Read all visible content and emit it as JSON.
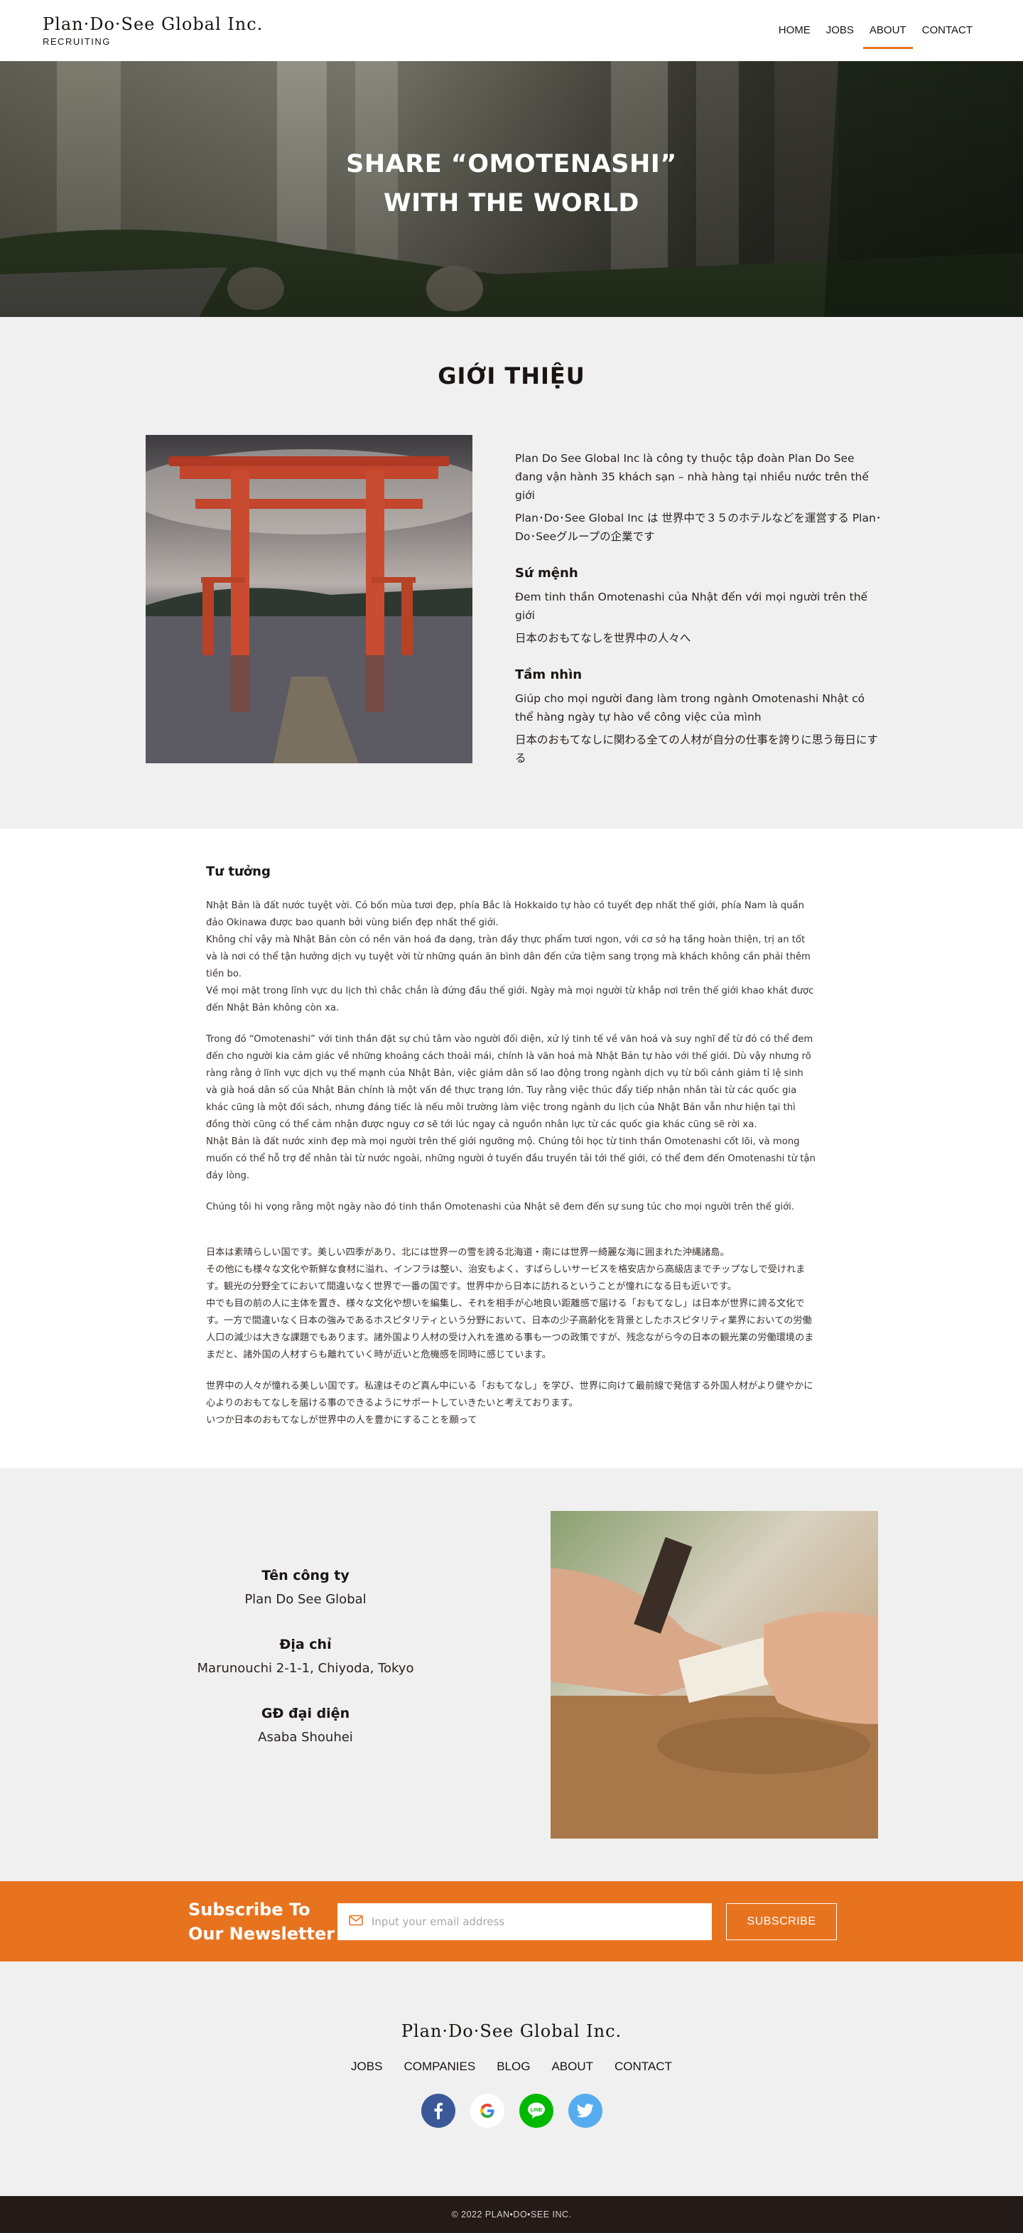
{
  "header": {
    "logo": "Plan·Do·See Global Inc.",
    "logo_sub": "RECRUITING",
    "nav": [
      "HOME",
      "JOBS",
      "ABOUT",
      "CONTACT"
    ],
    "active_nav": "ABOUT",
    "accent_color": "#e8731f"
  },
  "hero": {
    "title_line1": "SHARE “OMOTENASHI”",
    "title_line2": "WITH THE WORLD"
  },
  "intro": {
    "heading": "GIỚI THIỆU",
    "p1": "Plan Do See Global Inc là công ty thuộc tập đoàn Plan Do See đang vận hành 35 khách sạn – nhà hàng tại nhiều nước trên thế giới",
    "p2": "Plan･Do･See Global Inc は 世界中で３５のホテルなどを運営する Plan･Do･Seeグループの企業です",
    "mission_title": "Sứ mệnh",
    "mission_vi": "Đem tinh thần Omotenashi của Nhật đến với mọi người trên thế giới",
    "mission_ja": "日本のおもてなしを世界中の人々へ",
    "vision_title": "Tầm nhìn",
    "vision_vi": "Giúp cho mọi người đang làm trong ngành Omotenashi Nhật có thể hàng ngày tự hào về công việc của mình",
    "vision_ja": "日本のおもてなしに関わる全ての人材が自分の仕事を誇りに思う毎日にする"
  },
  "philosophy": {
    "title": "Tư tưởng",
    "vi_1": "Nhật Bản là đất nước tuyệt vời. Có bốn mùa tươi đẹp, phía Bắc là Hokkaido tự hào có tuyết đẹp nhất thế giới, phía Nam là quần đảo Okinawa được bao quanh bởi vùng biển đẹp nhất thế giới.",
    "vi_2": "Không chỉ vậy mà Nhật Bản còn có nền văn hoá đa dạng, tràn đầy thực phẩm tươi ngon, với cơ sở hạ tầng hoàn thiện, trị an tốt và là nơi có thể tận hưởng dịch vụ tuyệt vời từ những quán ăn bình dân đến cửa tiệm sang trọng mà khách không cần phải thêm tiền bo.",
    "vi_3": "Về mọi mặt trong lĩnh vực du lịch thì chắc chắn là đứng đầu thế giới. Ngày mà mọi người từ khắp nơi trên thế giới khao khát được đến Nhật Bản không còn xa.",
    "vi_4": "Trong đó “Omotenashi” với tinh thần đặt sự chú tâm vào người đối diện, xử lý tinh tế về văn hoá và suy nghĩ để từ đó có thể đem đến cho người kia cảm giác về những khoảng cách thoải mái, chính là văn hoá mà Nhật Bản tự hào với thế giới. Dù vậy nhưng rõ ràng rằng ở lĩnh vực dịch vụ thế mạnh của Nhật Bản, việc giảm dân số lao động trong ngành dịch vụ từ bối cảnh giảm tỉ lệ sinh và già hoá dân số của Nhật Bản chính là một vấn đề thực trạng lớn. Tuy rằng việc thúc đẩy tiếp nhận nhân tài từ các quốc gia khác cũng là một đối sách, nhưng đáng tiếc là nếu môi trường làm việc trong ngành du lịch của Nhật Bản vẫn như hiện tại thì đồng thời cũng có thể cảm nhận được nguy cơ sẽ tới lúc ngay cả nguồn nhân lực từ các quốc gia khác cũng sẽ rời xa.",
    "vi_5": "Nhật Bản là đất nước xinh đẹp mà mọi người trên thế giới ngưỡng mộ. Chúng tôi học từ tinh thần Omotenashi cốt lõi, và mong muốn có thể hỗ trợ để nhân tài từ nước ngoài, những người ở tuyến đầu truyền tải tới thế giới, có thể đem đến Omotenashi từ tận đáy lòng.",
    "vi_6": "Chúng tôi hi vọng rằng một ngày nào đó tinh thần Omotenashi của Nhật sẽ đem đến sự sung túc cho mọi người trên thế giới.",
    "ja_1": "日本は素晴らしい国です。美しい四季があり、北には世界一の雪を誇る北海道・南には世界一綺麗な海に囲まれた沖縄諸島。",
    "ja_2": "その他にも様々な文化や新鮮な食材に溢れ、インフラは整い、治安もよく、すばらしいサービスを格安店から高級店までチップなしで受けれます。観光の分野全てにおいて間違いなく世界で一番の国です。世界中から日本に訪れるということが憧れになる日も近いです。",
    "ja_3": "中でも目の前の人に主体を置き、様々な文化や想いを編集し、それを相手が心地良い距離感で届ける「おもてなし」は日本が世界に誇る文化です。一方で間違いなく日本の強みであるホスピタリティという分野において、日本の少子高齢化を背景としたホスピタリティ業界においての労働人口の減少は大きな課題でもあります。諸外国より人材の受け入れを進める事も一つの政策ですが、残念ながら今の日本の観光業の労働環境のままだと、諸外国の人材すらも離れていく時が近いと危機感を同時に感じています。",
    "ja_4": "世界中の人々が憧れる美しい国です。私達はそのど真ん中にいる「おもてなし」を学び、世界に向けて最前線で発信する外国人材がより健やかに心よりのおもてなしを届ける事のできるようにサポートしていきたいと考えております。",
    "ja_5": "いつか日本のおもてなしが世界中の人を豊かにすることを願って"
  },
  "company": {
    "name_label": "Tên công ty",
    "name_value": "Plan Do See Global",
    "address_label": "Địa chỉ",
    "address_value": "Marunouchi 2-1-1, Chiyoda, Tokyo",
    "rep_label": "GĐ đại diện",
    "rep_value": "Asaba Shouhei"
  },
  "newsletter": {
    "title_line1": "Subscribe To",
    "title_line2": "Our Newsletter",
    "placeholder": "Input your email address",
    "button": "SUBSCRIBE",
    "icon": "mail-icon"
  },
  "footer": {
    "logo": "Plan·Do·See Global Inc.",
    "nav": [
      "JOBS",
      "COMPANIES",
      "BLOG",
      "ABOUT",
      "CONTACT"
    ],
    "social": [
      "facebook-icon",
      "google-icon",
      "line-icon",
      "twitter-icon"
    ],
    "copyright": "© 2022 PLAN•DO•SEE INC."
  }
}
